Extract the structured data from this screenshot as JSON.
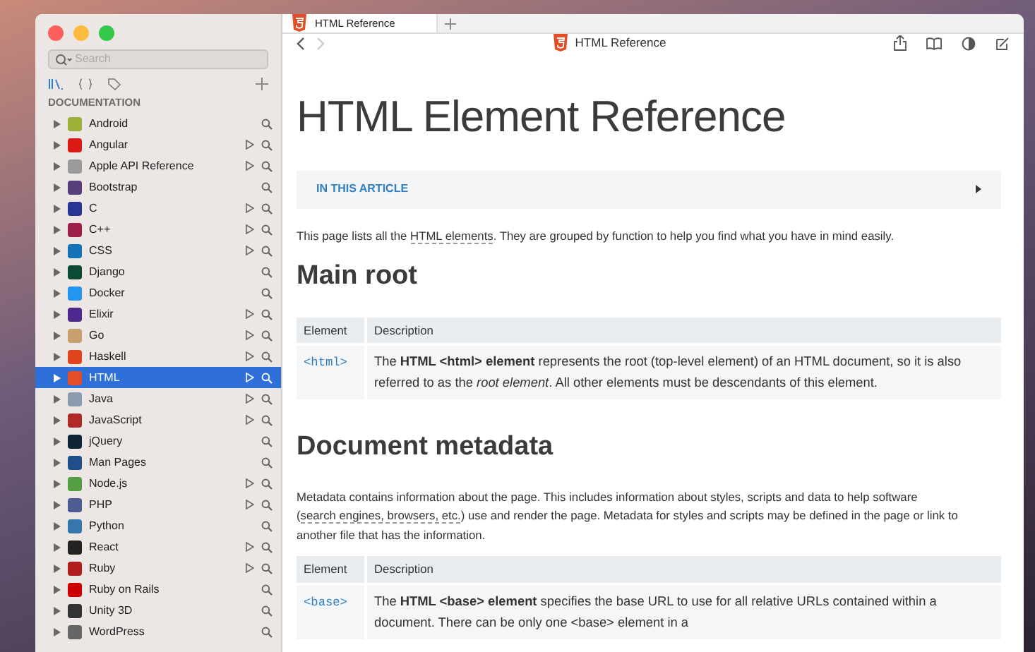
{
  "sidebar": {
    "search": {
      "placeholder": "Search"
    },
    "section": "DOCUMENTATION",
    "items": [
      {
        "name": "Android",
        "color": "#9bb13a",
        "playable": false,
        "selected": false
      },
      {
        "name": "Angular",
        "color": "#dd1b16",
        "playable": true,
        "selected": false
      },
      {
        "name": "Apple API Reference",
        "color": "#9a9a9a",
        "playable": true,
        "selected": false
      },
      {
        "name": "Bootstrap",
        "color": "#563d7c",
        "playable": false,
        "selected": false
      },
      {
        "name": "C",
        "color": "#283593",
        "playable": true,
        "selected": false
      },
      {
        "name": "C++",
        "color": "#9c1f4a",
        "playable": true,
        "selected": false
      },
      {
        "name": "CSS",
        "color": "#1572b6",
        "playable": true,
        "selected": false
      },
      {
        "name": "Django",
        "color": "#0c4b33",
        "playable": false,
        "selected": false
      },
      {
        "name": "Docker",
        "color": "#2496ed",
        "playable": false,
        "selected": false
      },
      {
        "name": "Elixir",
        "color": "#4e2a8e",
        "playable": true,
        "selected": false
      },
      {
        "name": "Go",
        "color": "#c8a070",
        "playable": true,
        "selected": false
      },
      {
        "name": "Haskell",
        "color": "#e0451f",
        "playable": true,
        "selected": false
      },
      {
        "name": "HTML",
        "color": "#e44d26",
        "playable": true,
        "selected": true
      },
      {
        "name": "Java",
        "color": "#8a9bb0",
        "playable": true,
        "selected": false
      },
      {
        "name": "JavaScript",
        "color": "#b02a2a",
        "playable": true,
        "selected": false
      },
      {
        "name": "jQuery",
        "color": "#0d2535",
        "playable": false,
        "selected": false
      },
      {
        "name": "Man Pages",
        "color": "#1f4e8c",
        "playable": false,
        "selected": false
      },
      {
        "name": "Node.js",
        "color": "#539e43",
        "playable": true,
        "selected": false
      },
      {
        "name": "PHP",
        "color": "#4f5b93",
        "playable": true,
        "selected": false
      },
      {
        "name": "Python",
        "color": "#3776ab",
        "playable": false,
        "selected": false
      },
      {
        "name": "React",
        "color": "#222222",
        "playable": true,
        "selected": false
      },
      {
        "name": "Ruby",
        "color": "#b11e1e",
        "playable": true,
        "selected": false
      },
      {
        "name": "Ruby on Rails",
        "color": "#cc0000",
        "playable": false,
        "selected": false
      },
      {
        "name": "Unity 3D",
        "color": "#333333",
        "playable": false,
        "selected": false
      },
      {
        "name": "WordPress",
        "color": "#666666",
        "playable": false,
        "selected": false
      }
    ]
  },
  "tabs": [
    {
      "label": "HTML Reference",
      "selected": true
    }
  ],
  "toolbar": {
    "title": "HTML Reference",
    "back_enabled": true,
    "forward_enabled": false
  },
  "article": {
    "title": "HTML Element Reference",
    "toc": "IN THIS ARTICLE",
    "intro": {
      "before": "This page lists all the ",
      "link": "HTML elements",
      "after": ". They are grouped by function to help you find what you have in mind easily."
    },
    "sections": [
      {
        "heading": "Main root",
        "table": {
          "columns": [
            "Element",
            "Description"
          ],
          "rows": [
            {
              "element": "<html>",
              "description": "The **HTML <html> element** represents the root (top-level element) of an HTML document, so it is also referred to as the *root element*. All other elements must be descendants of this element."
            }
          ]
        }
      },
      {
        "heading": "Document metadata",
        "text": {
          "before": "Metadata contains information about the page. This includes information about styles, scripts and data to help software (",
          "link": "search engines, browsers, etc.",
          "after": ") use and render the page. Metadata for styles and scripts may be defined in the page or link to another file that has the information."
        },
        "table": {
          "columns": [
            "Element",
            "Description"
          ],
          "rows": [
            {
              "element": "<base>",
              "description": "The **HTML <base> element** specifies the base URL to use for all relative URLs contained within a document. There can be only one <base> element in a"
            }
          ]
        }
      }
    ]
  }
}
